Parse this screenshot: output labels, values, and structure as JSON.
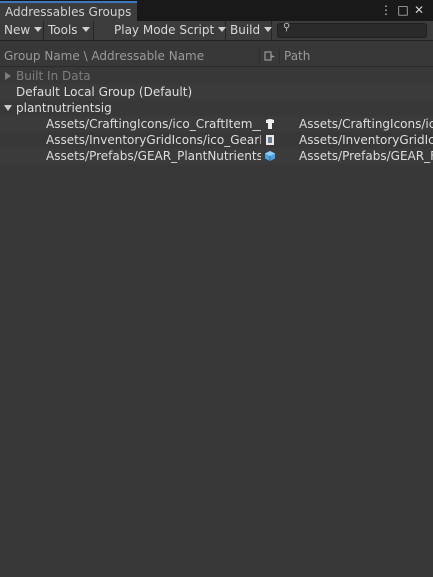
{
  "window": {
    "tab_title": "Addressables Groups",
    "menu_icon": "⋮",
    "maximize_icon": "□",
    "close_icon": "✕"
  },
  "toolbar": {
    "new_label": "New",
    "tools_label": "Tools",
    "play_mode_label": "Play Mode Script",
    "build_label": "Build",
    "search_value": "",
    "search_placeholder": ""
  },
  "columns": {
    "name": "Group Name \\ Addressable Name",
    "path": "Path"
  },
  "groups": [
    {
      "label": "Built In Data",
      "expanded": false
    },
    {
      "label": "Default Local Group (Default)"
    },
    {
      "label": "plantnutrientsig",
      "expanded": true
    }
  ],
  "entries": [
    {
      "name": "Assets/CraftingIcons/ico_CraftItem__Pl",
      "path": "Assets/CraftingIcons/ic",
      "icon": "texture-icon"
    },
    {
      "name": "Assets/InventoryGridIcons/ico_GearIte",
      "path": "Assets/InventoryGridIcc",
      "icon": "texture-icon"
    },
    {
      "name": "Assets/Prefabs/GEAR_PlantNutrientsC",
      "path": "Assets/Prefabs/GEAR_F",
      "icon": "prefab-icon"
    }
  ],
  "colors": {
    "background": "#383838",
    "tab_accent": "#3a79bb",
    "prefab_blue": "#4fa3e3"
  }
}
